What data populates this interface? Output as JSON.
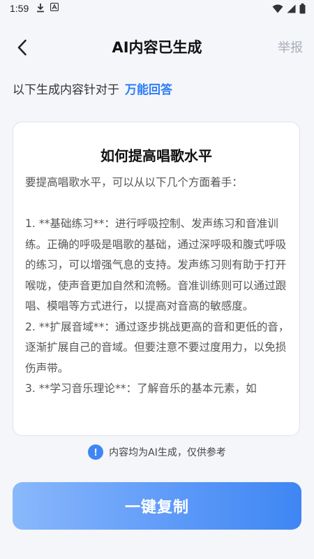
{
  "status_bar": {
    "time": "1:59"
  },
  "header": {
    "title": "AI内容已生成",
    "report_label": "举报"
  },
  "source": {
    "prefix": "以下生成内容针对于",
    "topic": "万能回答"
  },
  "card": {
    "title": "如何提高唱歌水平",
    "intro": "要提高唱歌水平，可以从以下几个方面着手：",
    "p1": "1. **基础练习**：进行呼吸控制、发声练习和音准训练。正确的呼吸是唱歌的基础，通过深呼吸和腹式呼吸的练习，可以增强气息的支持。发声练习则有助于打开喉咙，使声音更加自然和流畅。音准训练则可以通过跟唱、模唱等方式进行，以提高对音高的敏感度。",
    "p2": "2. **扩展音域**：通过逐步挑战更高的音和更低的音，逐渐扩展自己的音域。但要注意不要过度用力，以免损伤声带。",
    "p3": "3. **学习音乐理论**：了解音乐的基本元素，如"
  },
  "notice": {
    "text": "内容均为AI生成，仅供参考"
  },
  "actions": {
    "copy_label": "一键复制"
  },
  "colors": {
    "accent": "#2f7df6",
    "button_start": "#8ab8fb",
    "button_end": "#3f86f3",
    "muted": "#a9aeb7"
  },
  "icons": {
    "back": "chevron-left-icon",
    "info": "info-icon",
    "download": "download-icon",
    "wifi": "wifi-icon",
    "signal": "signal-icon",
    "battery": "battery-icon"
  }
}
